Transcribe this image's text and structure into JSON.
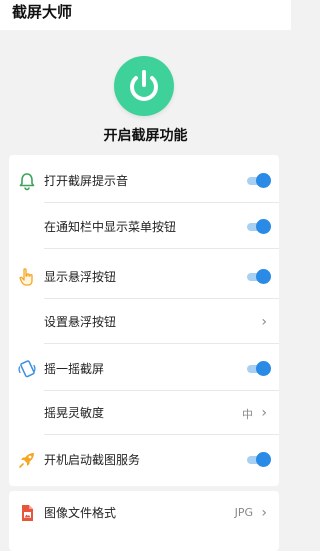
{
  "app": {
    "title": "截屏大师"
  },
  "main": {
    "power_label": "开启截屏功能",
    "power_color": "#3ed29a"
  },
  "settings": [
    {
      "label": "打开截屏提示音",
      "icon": "bell-icon",
      "control": "toggle",
      "on": true
    },
    {
      "label": "在通知栏中显示菜单按钮",
      "icon": null,
      "control": "toggle",
      "on": true
    },
    {
      "label": "显示悬浮按钮",
      "icon": "hand-pointer-icon",
      "control": "toggle",
      "on": true
    },
    {
      "label": "设置悬浮按钮",
      "icon": null,
      "control": "chevron"
    },
    {
      "label": "摇一摇截屏",
      "icon": "shake-phone-icon",
      "control": "toggle",
      "on": true
    },
    {
      "label": "摇晃灵敏度",
      "icon": null,
      "control": "value",
      "value": "中"
    },
    {
      "label": "开机启动截图服务",
      "icon": "rocket-icon",
      "control": "toggle",
      "on": true
    }
  ],
  "settings2": [
    {
      "label": "图像文件格式",
      "icon": "image-file-icon",
      "control": "value",
      "value": "JPG"
    }
  ],
  "colors": {
    "accent": "#2a8be6",
    "accent_track": "#a8d0f2",
    "bell": "#3ea35a",
    "hand": "#f5a623",
    "shake": "#3a8fe0",
    "rocket": "#f5a623",
    "image_file": "#e8553d"
  }
}
